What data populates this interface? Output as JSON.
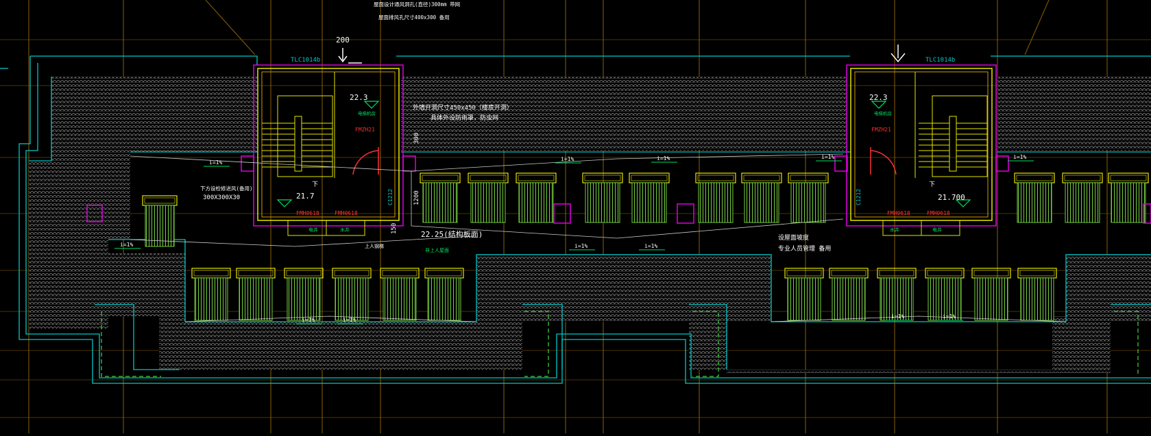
{
  "colors": {
    "background": "#000000",
    "grid": "#b8860b",
    "outline": "#00c8c8",
    "yellow": "#e6e600",
    "magenta": "#e000e0",
    "white": "#ffffff",
    "green": "#66cc33",
    "red": "#ff3030",
    "roof": "#8a8a8a"
  },
  "labels": {
    "top_note_1": "屋面设计通风洞孔(直径)300mm 带网",
    "top_note_2": "屋面排风孔尺寸400x300 备用",
    "dim_200": "200",
    "window_left": "TLC1014b",
    "window_right": "TLC1014b",
    "level_left_room": "22.3",
    "level_right_room": "22.3",
    "room_small_left": "电梯机房",
    "room_small_right": "电梯机房",
    "door_top_left": "FMZH21",
    "door_top_right": "FMZH21",
    "note_louver_1": "外墙开洞尺寸450x450（楼底开洞）",
    "note_louver_2": "具体外设防雨罩，防虫网",
    "dim_300": "300",
    "level_stair_left": "21.7",
    "level_stair_right": "21.700",
    "door_bottom_left_a": "FMH0618",
    "door_bottom_left_b": "FMH0618",
    "door_bottom_right_a": "FMH0618",
    "door_bottom_right_b": "FMH0618",
    "stair_dn_left": "下",
    "stair_dn_right": "下",
    "room_a_left": "电井",
    "room_b_left": "水井",
    "room_a_right": "水井",
    "room_b_right": "电井",
    "col_left": "C1212",
    "col_right": "C1212",
    "dim_1200": "1200",
    "dim_150": "150",
    "level_roof": "22.25(结构板面)",
    "note_vent_1": "下方设检修进风(备用)",
    "note_vent_2": "300X300X30",
    "ladder_note": "上人钢梯",
    "ladder_sub": "非上人屋面",
    "note_right_1": "设屋面坡度",
    "note_right_2": "专业人员管理 备用",
    "slope_label": "i=1%"
  },
  "icons": [
    "arrow-down-icon",
    "vent-square-icon",
    "level-triangle-icon"
  ]
}
